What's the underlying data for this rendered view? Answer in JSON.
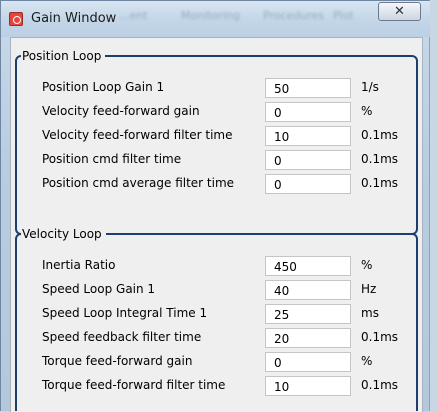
{
  "window": {
    "title": "Gain Window",
    "close_glyph": "✕",
    "ghost_menu": [
      "...ent",
      "Monitoring",
      "Procedures",
      "Plot"
    ]
  },
  "position_loop": {
    "title": "Position Loop",
    "rows": [
      {
        "label": "Position Loop Gain 1",
        "value": "50",
        "unit": "1/s"
      },
      {
        "label": "Velocity feed-forward gain",
        "value": "0",
        "unit": "%"
      },
      {
        "label": "Velocity feed-forward filter time",
        "value": "10",
        "unit": "0.1ms"
      },
      {
        "label": "Position cmd filter time",
        "value": "0",
        "unit": "0.1ms"
      },
      {
        "label": "Position cmd average filter time",
        "value": "0",
        "unit": "0.1ms"
      }
    ]
  },
  "velocity_loop": {
    "title": "Velocity Loop",
    "rows": [
      {
        "label": "Inertia Ratio",
        "value": "450",
        "unit": "%"
      },
      {
        "label": "Speed Loop Gain 1",
        "value": "40",
        "unit": "Hz"
      },
      {
        "label": "Speed Loop Integral Time 1",
        "value": "25",
        "unit": "ms"
      },
      {
        "label": "Speed feedback filter time",
        "value": "20",
        "unit": "0.1ms"
      },
      {
        "label": "Torque feed-forward gain",
        "value": "0",
        "unit": "%"
      },
      {
        "label": "Torque feed-forward filter time",
        "value": "10",
        "unit": "0.1ms"
      }
    ]
  },
  "icons": {
    "app": "app-icon",
    "close": "close-icon"
  },
  "colors": {
    "group_border": "#1c3f6e",
    "titlebar": "#c4d6e8",
    "panel_bg": "#efefef"
  }
}
